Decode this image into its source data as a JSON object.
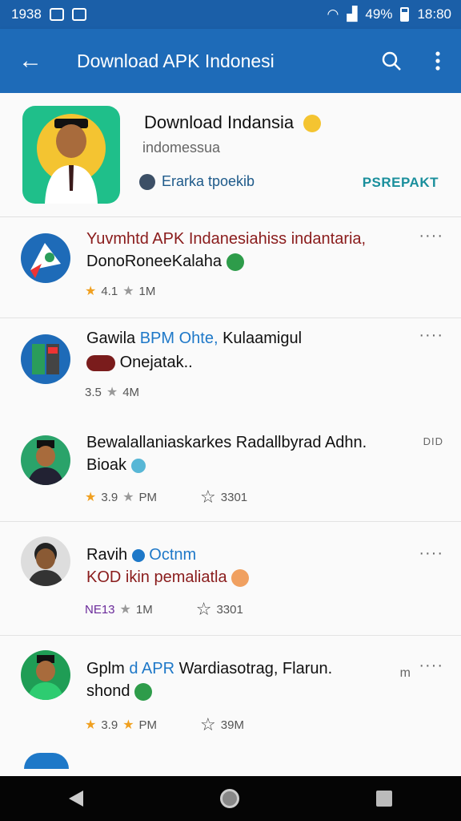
{
  "status_bar": {
    "left_text": "1938",
    "time": "18:80",
    "battery": "49%"
  },
  "app_bar": {
    "title": "Download APK Indonesi",
    "back_icon": "arrow-left-icon",
    "search_icon": "search-icon",
    "more_icon": "more-vert-icon"
  },
  "header": {
    "title": "Download Indansia",
    "subtitle": "indomessua",
    "developer": "Erarka tpoekib",
    "action_label": "PSREPAKT"
  },
  "items": [
    {
      "title_line1": "Yuvmhtd APK Indanesiahiss indantaria,",
      "title_line2": "DonoRoneeKalaha",
      "rating": "4.1",
      "downloads": "1M",
      "more": "····"
    },
    {
      "title_line1_a": "Gawila",
      "title_line1_b": "BPM Ohte,",
      "title_line1_c": "Kulaamigul",
      "title_line2": "Onejatak..",
      "rating": "3.5",
      "downloads": "4M",
      "more": "····"
    },
    {
      "title_line1": "Bewalallaniaskarkes Radallbyrad Adhn.",
      "title_line2": "Bioak",
      "rating": "3.9",
      "downloads": "PM",
      "reviews": "3301",
      "side_label": "DID"
    },
    {
      "title_line1_a": "Ravih",
      "title_line1_b": "Octnm",
      "title_line2": "KOD ikin pemaliatla",
      "rating": "NE13",
      "downloads": "1M",
      "reviews": "3301",
      "more": "····"
    },
    {
      "title_line1_a": "Gplm",
      "title_line1_b": "d APR",
      "title_line1_c": "Wardiasotrag, Flarun.",
      "title_line2": "shond",
      "rating": "3.9",
      "downloads": "PM",
      "reviews": "39M",
      "side_label": "m",
      "more": "····"
    }
  ]
}
